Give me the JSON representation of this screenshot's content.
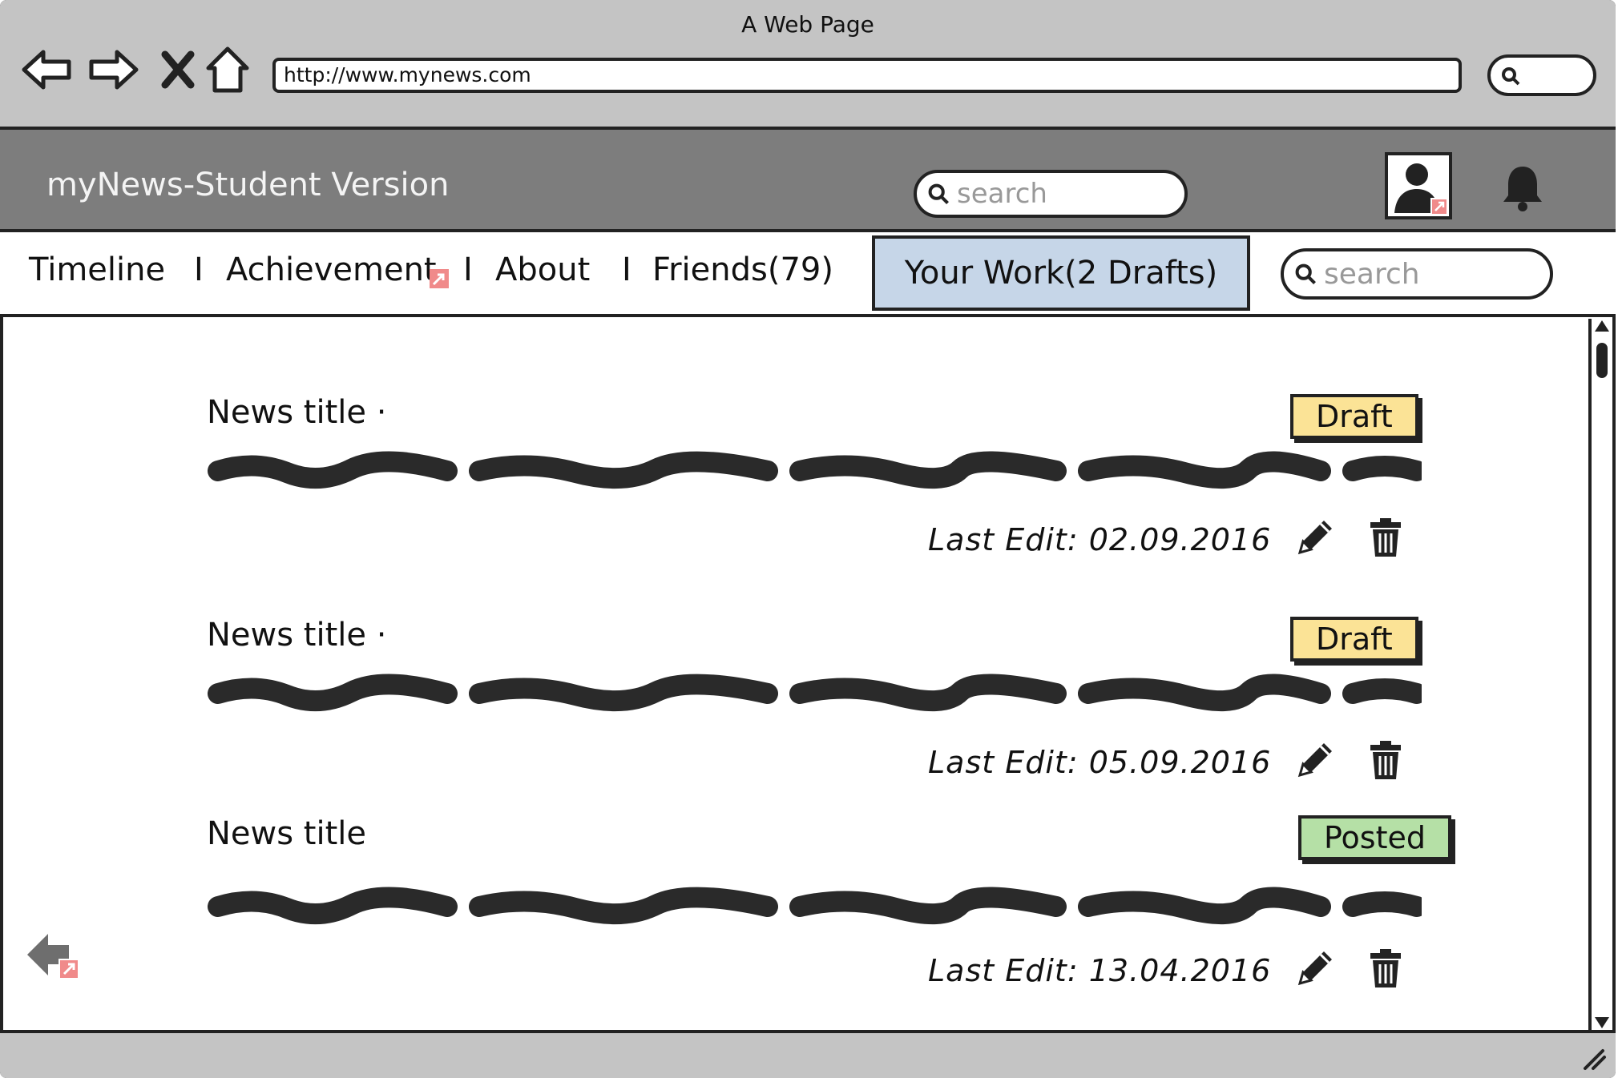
{
  "browser": {
    "window_title": "A Web Page",
    "url": "http://www.mynews.com",
    "icons": [
      "back-arrow-icon",
      "forward-arrow-icon",
      "close-icon",
      "home-icon",
      "search-icon"
    ]
  },
  "header": {
    "app_title": "myNews-Student Version",
    "search_placeholder": "search",
    "icons": [
      "avatar-icon",
      "bell-icon"
    ]
  },
  "tabs": {
    "items": [
      {
        "label": "Timeline"
      },
      {
        "label": "Achievement"
      },
      {
        "label": "About"
      },
      {
        "label": "Friends(79)"
      }
    ],
    "separator": "I",
    "active": {
      "label": "Your Work(2 Drafts)"
    },
    "search_placeholder": "search"
  },
  "articles": [
    {
      "title": "News title ·",
      "status": "Draft",
      "last_edit": "Last Edit: 02.09.2016"
    },
    {
      "title": "News title ·",
      "status": "Draft",
      "last_edit": "Last Edit: 05.09.2016"
    },
    {
      "title": "News title",
      "status": "Posted",
      "last_edit": "Last Edit: 13.04.2016"
    }
  ],
  "colors": {
    "draft_badge": "#fbe396",
    "posted_badge": "#b5e0a6",
    "active_tab": "#c6d6e8",
    "header_bg": "#7d7d7d",
    "chrome_bg": "#c4c4c4"
  }
}
